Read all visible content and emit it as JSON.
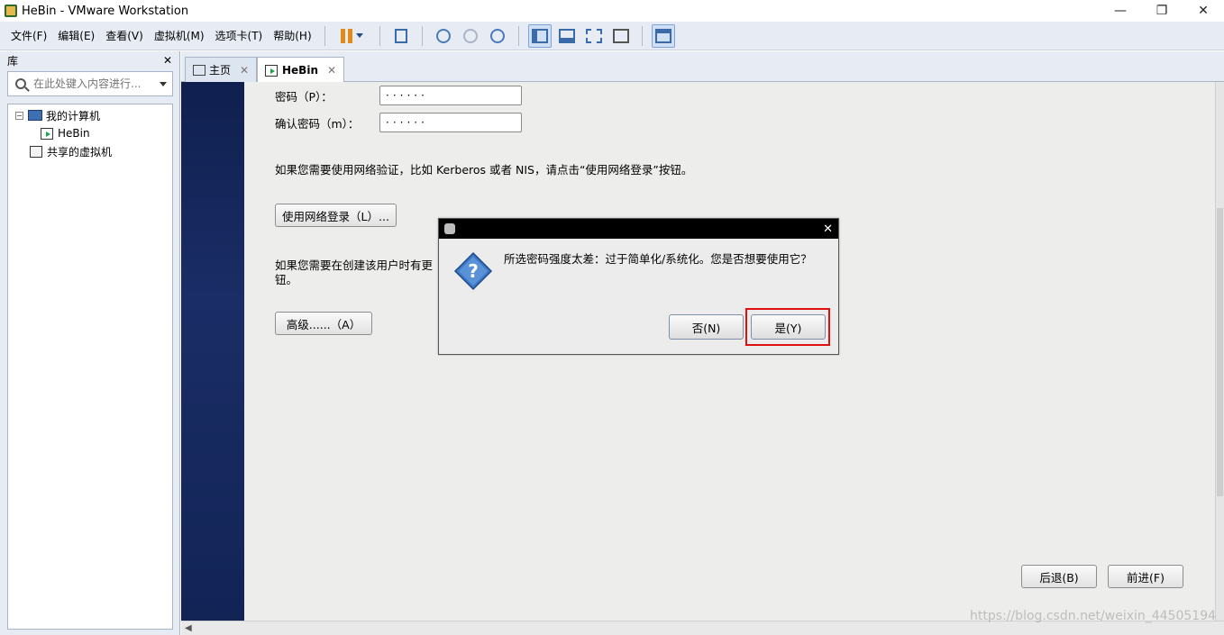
{
  "window": {
    "title": "HeBin - VMware Workstation",
    "min": "—",
    "restore": "❐",
    "close": "✕"
  },
  "menu": [
    "文件(F)",
    "编辑(E)",
    "查看(V)",
    "虚拟机(M)",
    "选项卡(T)",
    "帮助(H)"
  ],
  "library": {
    "title": "库",
    "close": "✕",
    "search_placeholder": "在此处键入内容进行...",
    "tree": {
      "my_computer": "我的计算机",
      "vm": "HeBin",
      "shared": "共享的虚拟机",
      "expander": "−"
    }
  },
  "tabs": [
    {
      "label": "主页",
      "close": "✕"
    },
    {
      "label": "HeBin",
      "close": "✕"
    }
  ],
  "form": {
    "password_label": "密码（P）：",
    "password_value": "······",
    "confirm_label": "确认密码（m）：",
    "confirm_value": "······",
    "network_text": "如果您需要使用网络验证，比如 Kerberos 或者 NIS，请点击“使用网络登录”按钮。",
    "network_button": "使用网络登录（L）...",
    "advanced_text_1": "如果您需要在创建该用户时有更",
    "advanced_text_2": "钮。",
    "advanced_button": "高级......（A）",
    "back_button": "后退(B)",
    "forward_button": "前进(F)"
  },
  "dialog": {
    "close": "✕",
    "message": "所选密码强度太差：过于简单化/系统化。您是否想要使用它？",
    "no_button": "否(N)",
    "yes_button": "是(Y)"
  },
  "watermark": "https://blog.csdn.net/weixin_44505194",
  "colors": {
    "accent": "#3b6aa8",
    "highlight": "#e01010",
    "vm_side": "#0f1f4f"
  }
}
